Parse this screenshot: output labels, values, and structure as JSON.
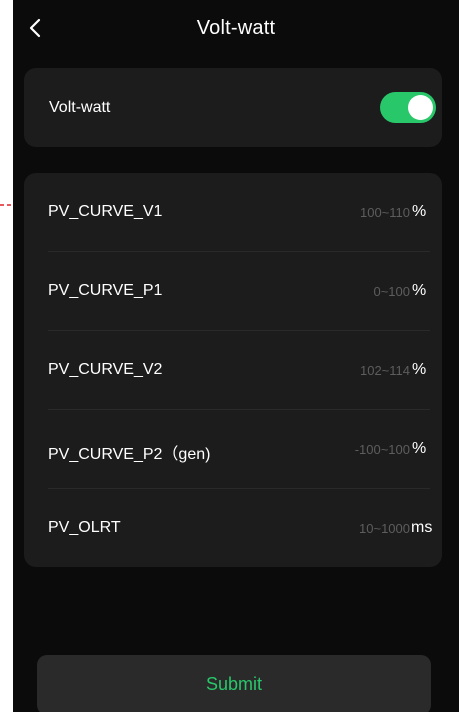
{
  "header": {
    "title": "Volt-watt",
    "back_icon": "chevron-left-icon"
  },
  "toggle_section": {
    "label": "Volt-watt",
    "enabled": true,
    "color": "#28c76a"
  },
  "params": [
    {
      "label": "PV_CURVE_V1",
      "range": "100~110",
      "unit": "%"
    },
    {
      "label": "PV_CURVE_P1",
      "range": "0~100",
      "unit": "%"
    },
    {
      "label": "PV_CURVE_V2",
      "range": "102~114",
      "unit": "%"
    },
    {
      "label": "PV_CURVE_P2（gen)",
      "range": "-100~100",
      "unit": "%"
    },
    {
      "label": "PV_OLRT",
      "range": "10~1000",
      "unit": "ms"
    }
  ],
  "footer": {
    "submit_label": "Submit"
  },
  "annotation": {
    "type": "dashed-arrow",
    "color": "#e0202a"
  }
}
